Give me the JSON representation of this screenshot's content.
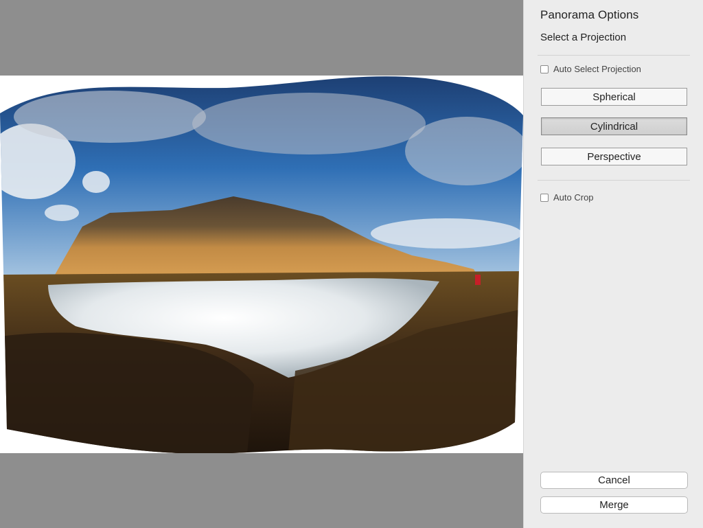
{
  "panel": {
    "title": "Panorama Options",
    "subtitle": "Select a Projection",
    "auto_select_projection": {
      "label": "Auto Select Projection",
      "checked": false
    },
    "projections": [
      {
        "label": "Spherical",
        "selected": false
      },
      {
        "label": "Cylindrical",
        "selected": true
      },
      {
        "label": "Perspective",
        "selected": false
      }
    ],
    "auto_crop": {
      "label": "Auto Crop",
      "checked": false
    },
    "cancel_label": "Cancel",
    "merge_label": "Merge"
  },
  "colors": {
    "preview_background": "#8e8e8e",
    "panel_background": "#ececec",
    "selected_button": "#d4d4d4",
    "sky": "#2f6fb5",
    "cliff": "#c28b45",
    "water": "#e8ecef",
    "ground": "#3b2816"
  }
}
